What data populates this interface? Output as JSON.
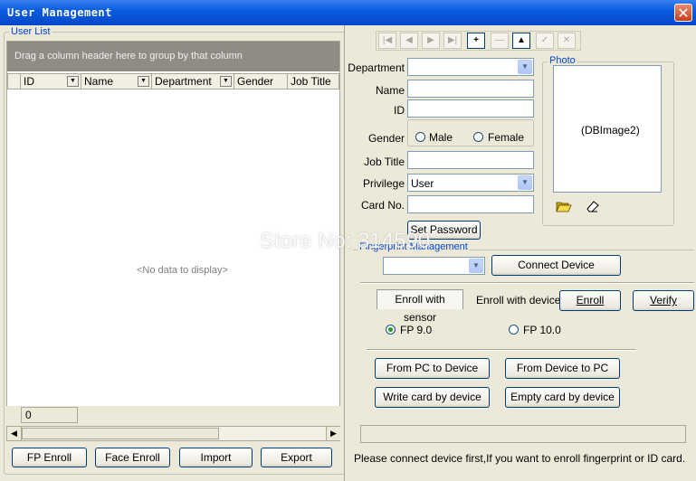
{
  "window": {
    "title": "User Management",
    "close_glyph": "✕"
  },
  "user_list": {
    "caption": "User List",
    "group_hint": "Drag a column header here to group by that column",
    "columns": [
      "ID",
      "Name",
      "Department",
      "Gender",
      "Job Title"
    ],
    "empty_text": "<No data to display>",
    "footer_value": "0"
  },
  "bottom_buttons": {
    "fp_enroll": "FP Enroll",
    "face_enroll": "Face Enroll",
    "import": "Import",
    "export": "Export"
  },
  "nav": {
    "first": "|◀",
    "prior": "◀",
    "next": "▶",
    "last": "▶|",
    "insert": "+",
    "delete": "—",
    "edit": "▲",
    "post": "✓",
    "cancel": "✕",
    "refresh": "↻"
  },
  "form": {
    "department_label": "Department",
    "department_value": "",
    "name_label": "Name",
    "name_value": "",
    "id_label": "ID",
    "id_value": "",
    "gender_label": "Gender",
    "gender_male": "Male",
    "gender_female": "Female",
    "job_title_label": "Job Title",
    "job_title_value": "",
    "privilege_label": "Privilege",
    "privilege_value": "User",
    "card_no_label": "Card No.",
    "card_no_value": "",
    "set_password": "Set Password"
  },
  "photo": {
    "caption": "Photo",
    "placeholder": "(DBImage2)"
  },
  "fingerprint": {
    "caption": "Fingerprint Management",
    "device_value": "",
    "connect_device": "Connect Device",
    "tab_sensor": "Enroll with sensor",
    "tab_device": "Enroll with device",
    "enroll": "Enroll",
    "verify": "Verify",
    "fp9": "FP 9.0",
    "fp10": "FP 10.0",
    "fp_version_selected": "FP 9.0",
    "from_pc_to_device": "From PC to Device",
    "from_device_to_pc": "From Device to PC",
    "write_card": "Write card by device",
    "empty_card": "Empty card by device"
  },
  "status": {
    "message": "Please connect device first,If you want to enroll fingerprint or ID card."
  },
  "watermark": "Store No: 314590",
  "colors": {
    "title_bar": "#0a5ce0",
    "caption_blue": "#0046d5",
    "face": "#ece9d8",
    "radio_dot": "#21a121",
    "close_red": "#c8401f"
  }
}
